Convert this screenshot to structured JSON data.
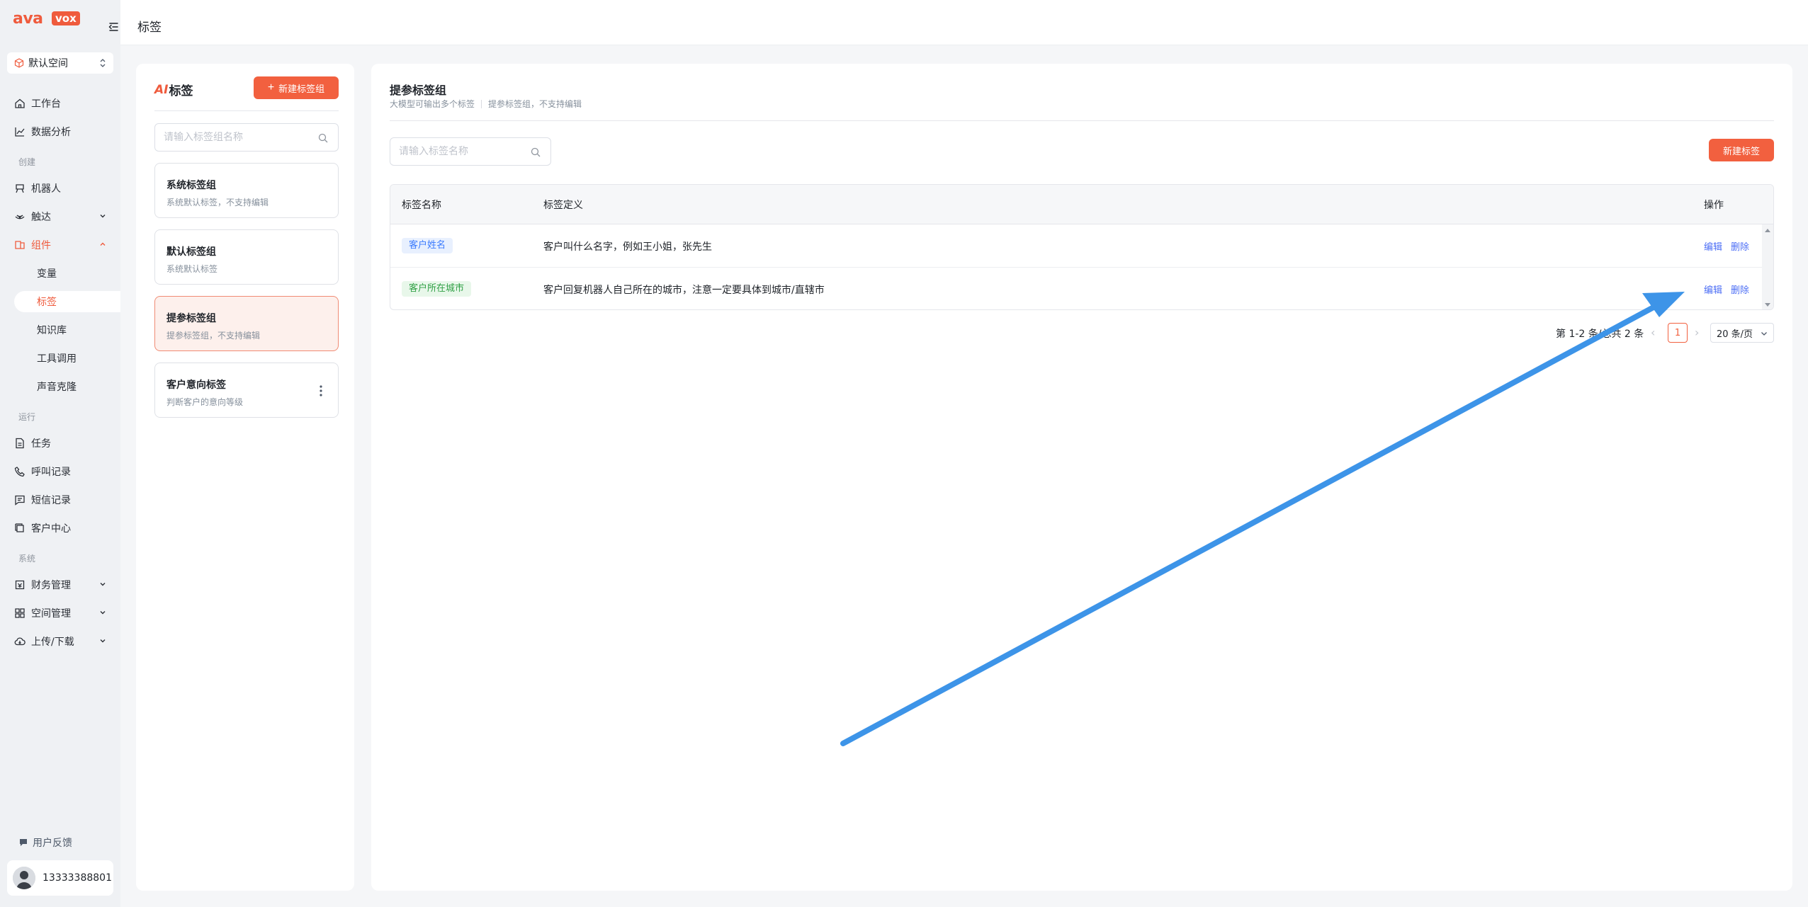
{
  "brand": {
    "logo_left": "ava",
    "logo_right": "vox"
  },
  "sidebar": {
    "space_label": "默认空间",
    "items_top": [
      {
        "label": "工作台"
      },
      {
        "label": "数据分析"
      }
    ],
    "section_create": "创建",
    "items_create": [
      {
        "label": "机器人"
      },
      {
        "label": "触达"
      },
      {
        "label": "组件"
      }
    ],
    "component_sub": [
      {
        "label": "变量"
      },
      {
        "label": "标签"
      },
      {
        "label": "知识库"
      },
      {
        "label": "工具调用"
      },
      {
        "label": "声音克隆"
      }
    ],
    "section_run": "运行",
    "items_run": [
      {
        "label": "任务"
      },
      {
        "label": "呼叫记录"
      },
      {
        "label": "短信记录"
      },
      {
        "label": "客户中心"
      }
    ],
    "section_system": "系统",
    "items_system": [
      {
        "label": "财务管理"
      },
      {
        "label": "空间管理"
      },
      {
        "label": "上传/下载"
      }
    ],
    "feedback": "用户反馈",
    "user_phone": "13333388801"
  },
  "header": {
    "title": "标签"
  },
  "groups": {
    "title_prefix": "AI",
    "title": "标签",
    "new_group_label": "新建标签组",
    "search_placeholder": "请输入标签组名称",
    "cards": [
      {
        "name": "系统标签组",
        "desc": "系统默认标签，不支持编辑"
      },
      {
        "name": "默认标签组",
        "desc": "系统默认标签"
      },
      {
        "name": "提参标签组",
        "desc": "提参标签组，不支持编辑"
      },
      {
        "name": "客户意向标签",
        "desc": "判断客户的意向等级"
      }
    ]
  },
  "main": {
    "title": "提参标签组",
    "subtitle_a": "大模型可输出多个标签",
    "subtitle_b": "提参标签组，不支持编辑",
    "search_placeholder": "请输入标签名称",
    "new_tag_label": "新建标签",
    "columns": {
      "name": "标签名称",
      "definition": "标签定义",
      "actions": "操作"
    },
    "rows": [
      {
        "name": "客户姓名",
        "definition": "客户叫什么名字，例如王小姐，张先生",
        "edit": "编辑",
        "delete": "删除",
        "chip_color": "#3a7afe"
      },
      {
        "name": "客户所在城市",
        "definition": "客户回复机器人自己所在的城市，注意一定要具体到城市/直辖市",
        "edit": "编辑",
        "delete": "删除",
        "chip_color": "#30a046"
      }
    ],
    "pagination": {
      "total_text": "第 1-2 条/总共 2 条",
      "current_page": "1",
      "page_size": "20 条/页"
    }
  },
  "colors": {
    "accent": "#f2603f",
    "link": "#4c6ef5",
    "annotation": "#3d94e8"
  }
}
